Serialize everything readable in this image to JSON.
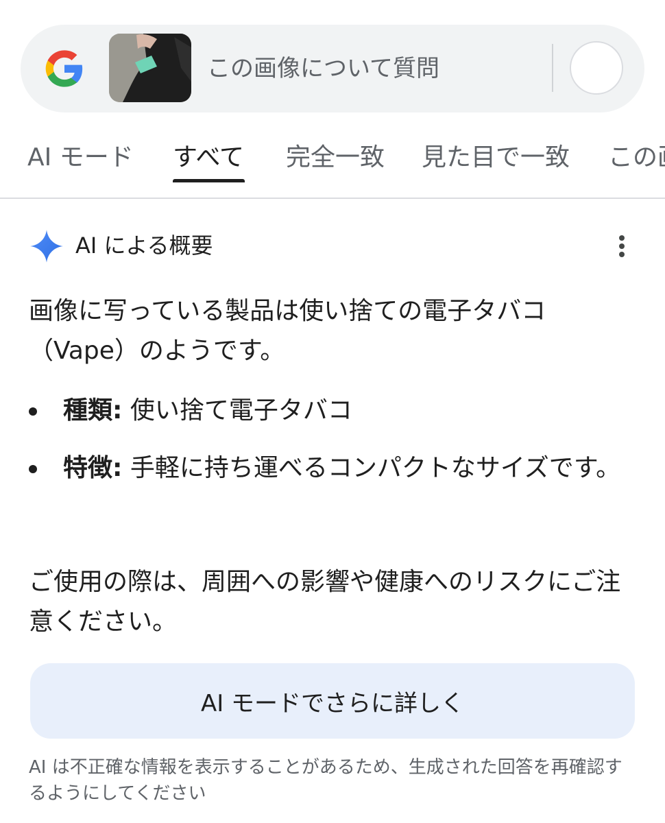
{
  "search": {
    "query_placeholder": "この画像について質問"
  },
  "tabs": [
    {
      "label": "AI モード",
      "active": false
    },
    {
      "label": "すべて",
      "active": true
    },
    {
      "label": "完全一致",
      "active": false
    },
    {
      "label": "見た目で一致",
      "active": false
    },
    {
      "label": "この画",
      "active": false
    }
  ],
  "ai_overview": {
    "title": "AI による概要",
    "intro": "画像に写っている製品は使い捨ての電子タバコ（Vape）のようです。",
    "bullets": [
      {
        "label": "種類:",
        "text": " 使い捨て電子タバコ"
      },
      {
        "label": "特徴:",
        "text": " 手軽に持ち運べるコンパクトなサイズです。"
      }
    ],
    "caution": "ご使用の際は、周囲への影響や健康へのリスクにご注意ください。",
    "ai_mode_button": "AI モードでさらに詳しく",
    "disclaimer": "AI は不正確な情報を表示することがあるため、生成された回答を再確認するようにしてください"
  },
  "colors": {
    "accent_blue": "#4285f4",
    "button_bg": "#e8effb",
    "search_bg": "#f1f3f4"
  },
  "icons": {
    "logo": "google-g-logo",
    "spark": "gemini-spark-icon",
    "menu": "more-vert-icon"
  }
}
